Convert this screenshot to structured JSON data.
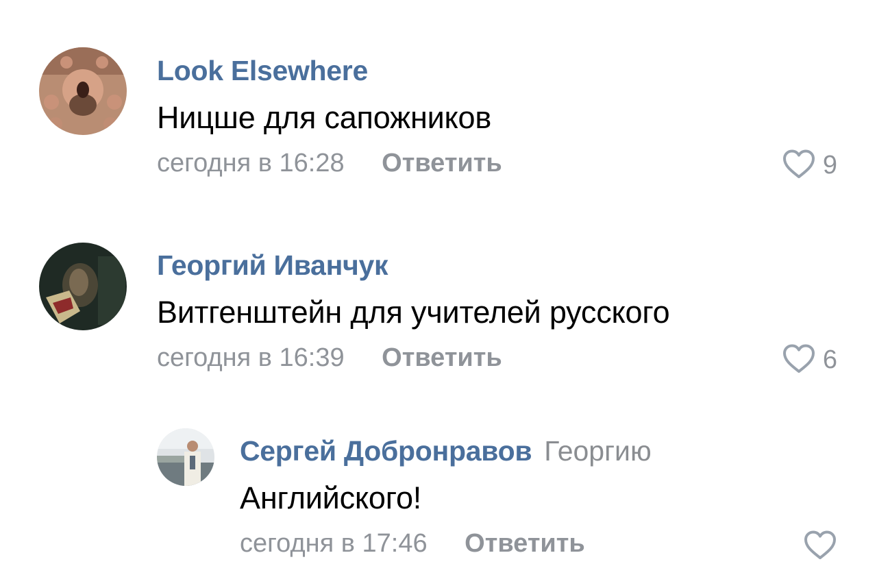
{
  "comments": [
    {
      "author": "Look Elsewhere",
      "text": "Ницше для сапожников",
      "time": "сегодня в 16:28",
      "reply_label": "Ответить",
      "likes": "9"
    },
    {
      "author": "Георгий Иванчук",
      "text": "Витгенштейн для учителей русского",
      "time": "сегодня в 16:39",
      "reply_label": "Ответить",
      "likes": "6"
    },
    {
      "author": "Сергей Добронравов",
      "reply_to": "Георгию",
      "text": "Английского!",
      "time": "сегодня в 17:46",
      "reply_label": "Ответить",
      "likes": ""
    }
  ],
  "icons": {
    "like": "heart-outline-icon"
  },
  "colors": {
    "author": "#4a6f9c",
    "meta": "#8f9399",
    "text": "#000000",
    "background": "#ffffff"
  }
}
